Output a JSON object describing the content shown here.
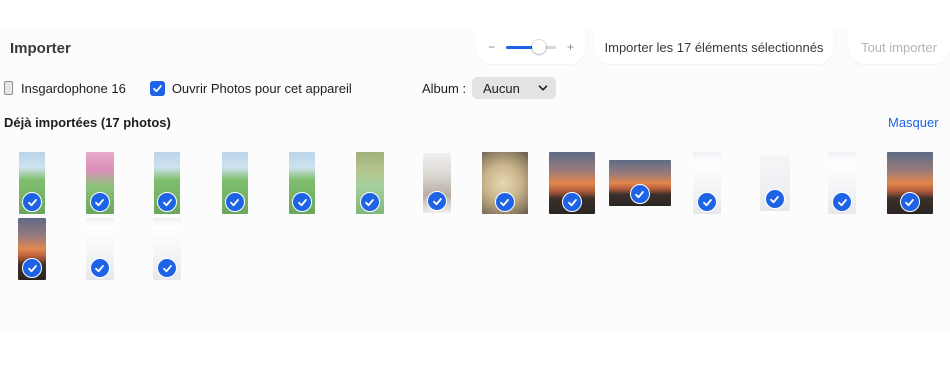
{
  "app": {
    "title": "Importer",
    "zoom": {
      "minus": "−",
      "plus": "+",
      "level": 0.65
    },
    "import_selected_label": "Importer les 17 éléments sélectionnés",
    "import_all_label": "Tout importer"
  },
  "device": {
    "name": "Insgardophone 16",
    "open_photos_label": "Ouvrir Photos pour cet appareil",
    "open_photos_checked": true
  },
  "album": {
    "label": "Album :",
    "value": "Aucun"
  },
  "section": {
    "title": "Déjà importées (17 photos)",
    "hide_label": "Masquer"
  },
  "colors": {
    "accent": "#1e63e6",
    "background": "#fcfcfc",
    "select_bg": "#e3e3e6"
  },
  "photos": [
    {
      "kind": "game",
      "selected": true
    },
    {
      "kind": "pink",
      "selected": true
    },
    {
      "kind": "game",
      "selected": true
    },
    {
      "kind": "game",
      "selected": true
    },
    {
      "kind": "game",
      "selected": true
    },
    {
      "kind": "tree",
      "selected": true
    },
    {
      "kind": "chat",
      "selected": true
    },
    {
      "kind": "food",
      "selected": true
    },
    {
      "kind": "sunset",
      "selected": true
    },
    {
      "kind": "sunset",
      "selected": true
    },
    {
      "kind": "set",
      "selected": true
    },
    {
      "kind": "panel",
      "selected": true
    },
    {
      "kind": "set",
      "selected": true
    },
    {
      "kind": "sunset",
      "selected": true
    },
    {
      "kind": "sunset",
      "selected": true
    },
    {
      "kind": "set",
      "selected": true
    },
    {
      "kind": "set",
      "selected": true
    }
  ]
}
